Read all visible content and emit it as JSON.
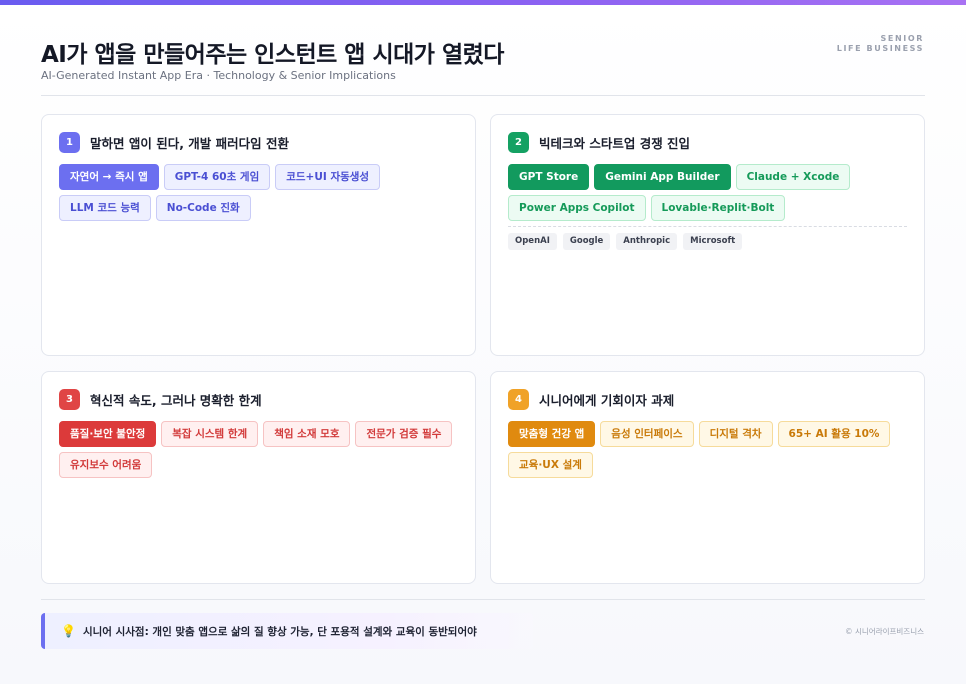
{
  "header": {
    "title": "AI가 앱을 만들어주는 인스턴트 앱 시대가 열렸다",
    "subtitle": "AI-Generated Instant App Era · Technology & Senior Implications",
    "brand_line1": "SENIOR",
    "brand_line2": "LIFE BUSINESS"
  },
  "cards": [
    {
      "number": "1",
      "title": "말하면 앱이 된다, 개발 패러다임 전환",
      "chips": [
        "자연어 → 즉시 앱",
        "GPT-4 60초 게임",
        "코드+UI 자동생성",
        "LLM 코드 능력",
        "No-Code 진화"
      ]
    },
    {
      "number": "2",
      "title": "빅테크와 스타트업 경쟁 진입",
      "chips": [
        "GPT Store",
        "Gemini App Builder",
        "Claude + Xcode",
        "Power Apps Copilot",
        "Lovable·Replit·Bolt"
      ],
      "companies": [
        "OpenAI",
        "Google",
        "Anthropic",
        "Microsoft"
      ]
    },
    {
      "number": "3",
      "title": "혁신적 속도, 그러나 명확한 한계",
      "chips": [
        "품질·보안 불안정",
        "복잡 시스템 한계",
        "책임 소재 모호",
        "전문가 검증 필수",
        "유지보수 어려움"
      ]
    },
    {
      "number": "4",
      "title": "시니어에게 기회이자 과제",
      "chips": [
        "맞춤형 건강 앱",
        "음성 인터페이스",
        "디지털 격차",
        "65+ AI 활용 10%",
        "교육·UX 설계"
      ]
    }
  ],
  "footer": {
    "insight_icon": "lightbulb-icon",
    "insight": "시니어 시사점: 개인 맞춤 앱으로 삶의 질 향상 가능, 단 포용적 설계와 교육이 동반되어야",
    "copyright": "© 시니어라이프비즈니스"
  },
  "colors": {
    "purple": "#6c6ff0",
    "green": "#129a5e",
    "red": "#dc3a3a",
    "orange": "#e08a0f"
  }
}
